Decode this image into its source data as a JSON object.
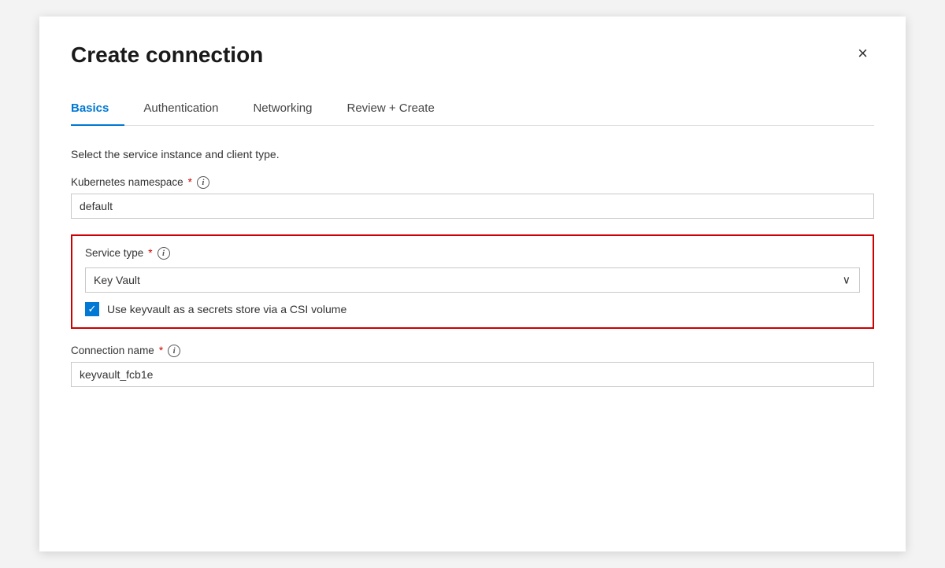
{
  "dialog": {
    "title": "Create connection",
    "close_label": "×"
  },
  "tabs": [
    {
      "id": "basics",
      "label": "Basics",
      "active": true
    },
    {
      "id": "authentication",
      "label": "Authentication",
      "active": false
    },
    {
      "id": "networking",
      "label": "Networking",
      "active": false
    },
    {
      "id": "review-create",
      "label": "Review + Create",
      "active": false
    }
  ],
  "section_description": "Select the service instance and client type.",
  "kubernetes_namespace": {
    "label": "Kubernetes namespace",
    "required": true,
    "info": "i",
    "value": "default"
  },
  "service_type": {
    "label": "Service type",
    "required": true,
    "info": "i",
    "value": "Key Vault",
    "options": [
      "Key Vault"
    ],
    "checkbox_label": "Use keyvault as a secrets store via a CSI volume",
    "checkbox_checked": true
  },
  "connection_name": {
    "label": "Connection name",
    "required": true,
    "info": "i",
    "value": "keyvault_fcb1e"
  },
  "icons": {
    "chevron_down": "∨",
    "check": "✓"
  }
}
